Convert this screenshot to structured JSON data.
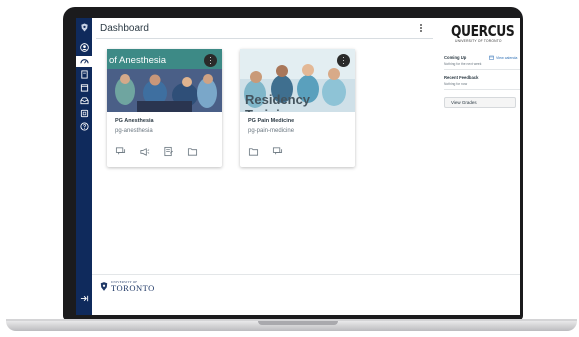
{
  "header": {
    "title": "Dashboard"
  },
  "global_nav": {
    "items": [
      "logo-icon",
      "account-icon",
      "dashboard-icon",
      "courses-icon",
      "calendar-icon",
      "inbox-icon",
      "history-icon",
      "help-icon"
    ],
    "active_index": 2,
    "bg_color": "#0f2a5c"
  },
  "cards": [
    {
      "banner_text": "of Anesthesia",
      "name": "PG Anesthesia",
      "code": "pg-anesthesia",
      "icons": [
        "announcements-icon",
        "discussions-icon",
        "assignments-icon",
        "files-icon"
      ]
    },
    {
      "banner_text": "Residency Training",
      "name": "PG Pain Medicine",
      "code": "pg-pain-medicine",
      "icons": [
        "files-icon",
        "discussions-icon"
      ]
    }
  ],
  "sidebar": {
    "logo": "QUERCUS",
    "logo_sub": "UNIVERSITY OF TORONTO",
    "coming_up": {
      "title": "Coming Up",
      "calendar_link": "View calenda",
      "note": "Nothing for the next week"
    },
    "recent_feedback": {
      "title": "Recent Feedback",
      "note": "Nothing for now"
    },
    "view_grades": "View Grades"
  },
  "footer": {
    "university_small": "UNIVERSITY OF",
    "university_big": "TORONTO"
  }
}
